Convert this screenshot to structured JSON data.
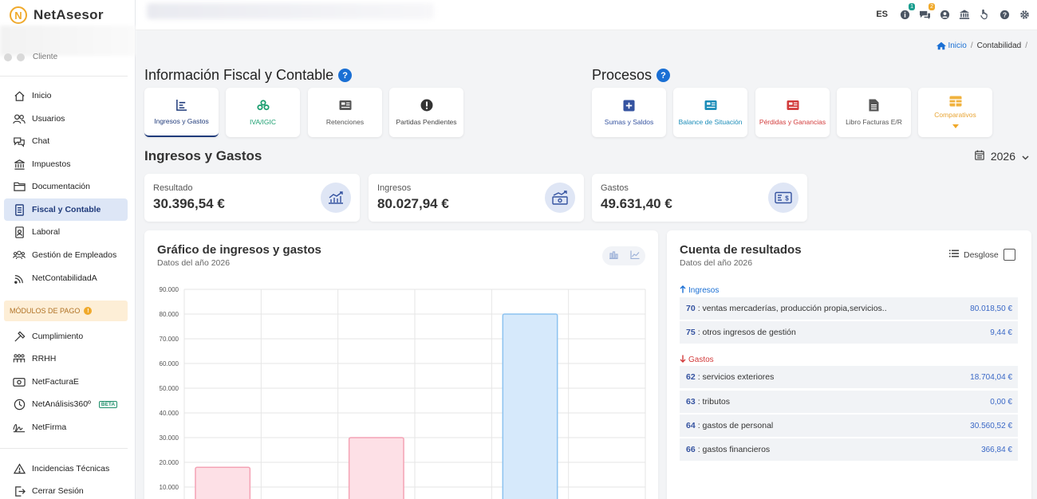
{
  "brand": {
    "name": "NetAsesor",
    "logo_letter": "N"
  },
  "client": {
    "label": "Cliente"
  },
  "sidebar": {
    "items": [
      {
        "label": "Inicio",
        "icon": "home-icon"
      },
      {
        "label": "Usuarios",
        "icon": "users-icon"
      },
      {
        "label": "Chat",
        "icon": "chat-icon"
      },
      {
        "label": "Impuestos",
        "icon": "bank-icon"
      },
      {
        "label": "Documentación",
        "icon": "folder-icon"
      },
      {
        "label": "Fiscal y Contable",
        "icon": "document-icon",
        "active": true
      },
      {
        "label": "Laboral",
        "icon": "id-badge-icon"
      },
      {
        "label": "Gestión de Empleados",
        "icon": "employees-icon"
      },
      {
        "label": "NetContabilidadA",
        "icon": "wifi-icon"
      }
    ],
    "modules_label": "MÓDULOS DE PAGO",
    "paid_items": [
      {
        "label": "Cumplimiento",
        "icon": "hammer-icon"
      },
      {
        "label": "RRHH",
        "icon": "team-icon"
      },
      {
        "label": "NetFacturaE",
        "icon": "cash-icon"
      },
      {
        "label": "NetAnálisis360º",
        "icon": "analysis-icon",
        "badge": "BETA"
      },
      {
        "label": "NetFirma",
        "icon": "signature-icon"
      }
    ],
    "bottom_items": [
      {
        "label": "Incidencias Técnicas",
        "icon": "warning-icon"
      },
      {
        "label": "Cerrar Sesión",
        "icon": "logout-icon"
      }
    ]
  },
  "topbar": {
    "lang": "ES",
    "badges": {
      "notifications": "1",
      "messages": "2"
    },
    "colors": {
      "notif_badge": "#1a9e8f",
      "msg_badge": "#f0a92a"
    }
  },
  "breadcrumb": {
    "home": "Inicio",
    "current": "Contabilidad"
  },
  "fiscal": {
    "title": "Información Fiscal y Contable",
    "tiles": [
      "Ingresos y Gastos",
      "IVA/IGIC",
      "Retenciones",
      "Partidas Pendientes"
    ]
  },
  "procesos": {
    "title": "Procesos",
    "tiles": [
      "Sumas y Saldos",
      "Balance de Situación",
      "Pérdidas y Ganancias",
      "Libro Facturas E/R",
      "Comparativos"
    ]
  },
  "section": {
    "title": "Ingresos y Gastos",
    "year": "2026"
  },
  "stats": [
    {
      "label": "Resultado",
      "value": "30.396,54 €"
    },
    {
      "label": "Ingresos",
      "value": "80.027,94 €"
    },
    {
      "label": "Gastos",
      "value": "49.631,40 €"
    }
  ],
  "chart_panel": {
    "title": "Gráfico de ingresos y gastos",
    "subtitle": "Datos del año 2026"
  },
  "chart_data": {
    "type": "bar",
    "y_ticks": [
      "90.000",
      "80.000",
      "70.000",
      "60.000",
      "50.000",
      "40.000",
      "30.000",
      "20.000",
      "10.000"
    ],
    "ylim": [
      0,
      90000
    ],
    "categories": [
      "",
      "",
      "",
      "",
      "",
      ""
    ],
    "bars": [
      {
        "slot": 0,
        "value": 18000,
        "kind": "gasto"
      },
      {
        "slot": 2,
        "value": 30000,
        "kind": "gasto"
      },
      {
        "slot": 4,
        "value": 80000,
        "kind": "ingreso"
      }
    ],
    "colors": {
      "gasto_fill": "#fde0e6",
      "gasto_stroke": "#f4a3b5",
      "ingreso_fill": "#d6e9fb",
      "ingreso_stroke": "#8cc2f0"
    },
    "grid": true
  },
  "cuenta": {
    "title": "Cuenta de resultados",
    "subtitle": "Datos del año 2026",
    "desglose_label": "Desglose",
    "ingresos_label": "Ingresos",
    "gastos_label": "Gastos",
    "ingresos": [
      {
        "code": "70",
        "desc": ": ventas mercaderías, producción propia,servicios..",
        "amount": "80.018,50 €"
      },
      {
        "code": "75",
        "desc": ": otros ingresos de gestión",
        "amount": "9,44 €"
      }
    ],
    "gastos": [
      {
        "code": "62",
        "desc": ": servicios exteriores",
        "amount": "18.704,04 €"
      },
      {
        "code": "63",
        "desc": ": tributos",
        "amount": "0,00 €"
      },
      {
        "code": "64",
        "desc": ": gastos de personal",
        "amount": "30.560,52 €"
      },
      {
        "code": "66",
        "desc": ": gastos financieros",
        "amount": "366,84 €"
      }
    ]
  }
}
